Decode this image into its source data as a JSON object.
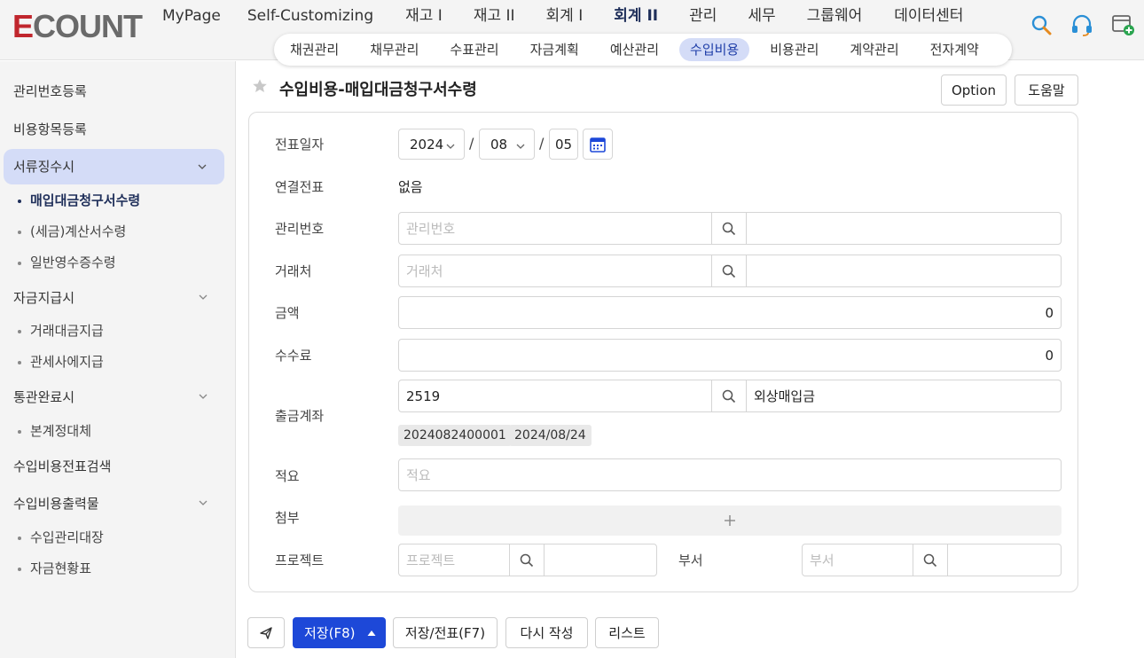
{
  "app": {
    "logo": "ECOUNT",
    "logo_e": "E",
    "logo_rest": "COUNT"
  },
  "top_menu": [
    {
      "label": "MyPage"
    },
    {
      "label": "Self-Customizing"
    },
    {
      "label": "재고 I"
    },
    {
      "label": "재고 II"
    },
    {
      "label": "회계 I"
    },
    {
      "label": "회계 II",
      "active": true
    },
    {
      "label": "관리"
    },
    {
      "label": "세무"
    },
    {
      "label": "그룹웨어"
    },
    {
      "label": "데이터센터"
    }
  ],
  "sub_tabs": [
    {
      "label": "채권관리"
    },
    {
      "label": "채무관리"
    },
    {
      "label": "수표관리"
    },
    {
      "label": "자금계획"
    },
    {
      "label": "예산관리"
    },
    {
      "label": "수입비용",
      "active": true
    },
    {
      "label": "비용관리"
    },
    {
      "label": "계약관리"
    },
    {
      "label": "전자계약"
    }
  ],
  "sidebar": {
    "items": [
      {
        "label": "관리번호등록"
      },
      {
        "label": "비용항목등록"
      },
      {
        "label": "서류징수시",
        "subs": [
          "매입대금청구서수령",
          "(세금)계산서수령",
          "일반영수증수령"
        ]
      },
      {
        "label": "자금지급시",
        "subs": [
          "거래대금지급",
          "관세사에지급"
        ]
      },
      {
        "label": "통관완료시",
        "subs": [
          "본계정대체"
        ]
      },
      {
        "label": "수입비용전표검색"
      },
      {
        "label": "수입비용출력물",
        "subs": [
          "수입관리대장",
          "자금현황표"
        ]
      }
    ]
  },
  "page": {
    "title": "수입비용-매입대금청구서수령",
    "option_button": "Option",
    "help_button": "도움말"
  },
  "form": {
    "date_label": "전표일자",
    "date_year": "2024",
    "date_month": "08",
    "date_day": "05",
    "date_sep": "/",
    "linked_label": "연결전표",
    "linked_value": "없음",
    "mgmt_label": "관리번호",
    "mgmt_placeholder": "관리번호",
    "customer_label": "거래처",
    "customer_placeholder": "거래처",
    "amount_label": "금액",
    "amount_value": "0",
    "fee_label": "수수료",
    "fee_value": "0",
    "account_label": "출금계좌",
    "account_code": "2519",
    "account_name": "외상매입금",
    "account_chip_1": "2024082400001",
    "account_chip_2": "2024/08/24",
    "memo_label": "적요",
    "memo_placeholder": "적요",
    "attach_label": "첨부",
    "project_label": "프로젝트",
    "project_placeholder": "프로젝트",
    "dept_label": "부서",
    "dept_placeholder": "부서"
  },
  "bottom": {
    "save": "저장(F8)",
    "save_slip": "저장/전표(F7)",
    "rewrite": "다시 작성",
    "list": "리스트"
  },
  "colors": {
    "primary": "#1d48d8",
    "active_tab_bg": "#d4dcf7",
    "logo_red": "#c0262d"
  }
}
